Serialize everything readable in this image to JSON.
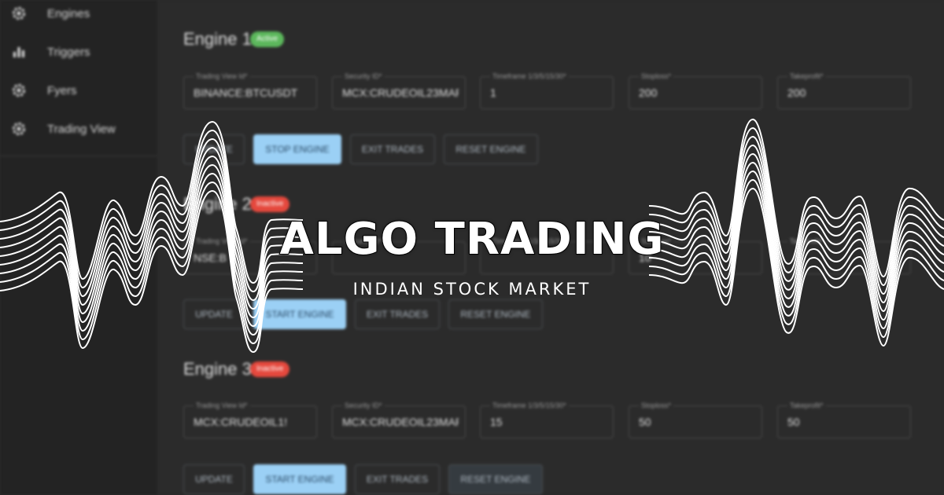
{
  "sidebar": {
    "items": [
      {
        "label": "Engines",
        "icon": "gear-icon"
      },
      {
        "label": "Triggers",
        "icon": "bar-chart-icon"
      },
      {
        "label": "Fyers",
        "icon": "gear-icon"
      },
      {
        "label": "Trading View",
        "icon": "gear-icon"
      }
    ]
  },
  "field_labels": {
    "tv_id": "Trading View Id*",
    "security_id": "Security ID*",
    "timeframe": "Timeframe 1/3/5/15/30*",
    "stoploss": "Stoploss*",
    "takeprofit": "Takeprofit*"
  },
  "buttons": {
    "update": "UPDATE",
    "stop": "STOP ENGINE",
    "start": "START ENGINE",
    "exit": "EXIT TRADES",
    "reset": "RESET ENGINE"
  },
  "engines": [
    {
      "title": "Engine 1",
      "status": "Active",
      "tv_id": "BINANCE:BTCUSDT",
      "security_id": "MCX:CRUDEOIL23MAF",
      "timeframe": "1",
      "stoploss": "200",
      "takeprofit": "200"
    },
    {
      "title": "Engine 2",
      "status": "Inactive",
      "tv_id": "NSE:B",
      "security_id": "",
      "timeframe": "",
      "stoploss": "10",
      "takeprofit": ""
    },
    {
      "title": "Engine 3",
      "status": "Inactive",
      "tv_id": "MCX:CRUDEOIL1!",
      "security_id": "MCX:CRUDEOIL23MAF",
      "timeframe": "15",
      "stoploss": "50",
      "takeprofit": "50"
    }
  ],
  "overlay": {
    "title": "ALGO TRADING",
    "subtitle": "INDIAN STOCK MARKET"
  },
  "colors": {
    "background": "#2b2b2b",
    "sidebar": "#232323",
    "active_badge": "#5cb85c",
    "inactive_badge": "#e5483d",
    "primary_button": "#9bd0f5"
  }
}
